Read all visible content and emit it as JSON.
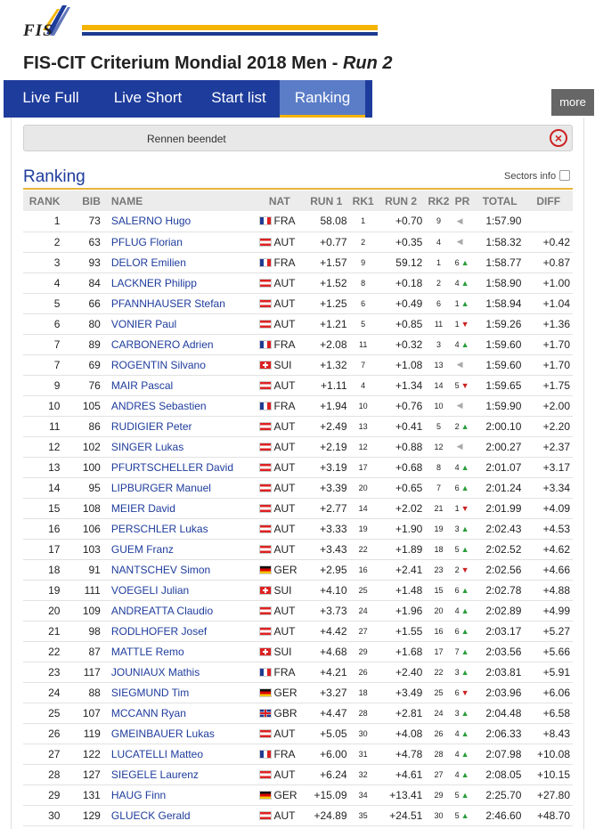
{
  "logo": {
    "text": "FIS"
  },
  "page": {
    "title_event": "FIS-CIT Criterium Mondial 2018 Men - ",
    "title_race": "Run 2"
  },
  "tabs": [
    {
      "label": "Live Full"
    },
    {
      "label": "Live Short"
    },
    {
      "label": "Start list"
    },
    {
      "label": "Ranking"
    }
  ],
  "more_label": "more",
  "notice": {
    "text": "Rennen beendet",
    "close_icon": "close-icon"
  },
  "ranking": {
    "title": "Ranking",
    "sectors_label": "Sectors info",
    "columns": [
      "RANK",
      "BIB",
      "NAME",
      "NAT",
      "RUN 1",
      "RK1",
      "RUN 2",
      "RK2",
      "PR",
      "TOTAL",
      "DIFF"
    ],
    "rows": [
      {
        "rank": "1",
        "bib": "73",
        "name": "SALERNO Hugo",
        "nat": "FRA",
        "run1": "58.08",
        "rk1": "1",
        "run2": "+0.70",
        "rk2": "9",
        "pr": "",
        "trend": "same",
        "total": "1:57.90",
        "diff": ""
      },
      {
        "rank": "2",
        "bib": "63",
        "name": "PFLUG Florian",
        "nat": "AUT",
        "run1": "+0.77",
        "rk1": "2",
        "run2": "+0.35",
        "rk2": "4",
        "pr": "",
        "trend": "same",
        "total": "1:58.32",
        "diff": "+0.42"
      },
      {
        "rank": "3",
        "bib": "93",
        "name": "DELOR Emilien",
        "nat": "FRA",
        "run1": "+1.57",
        "rk1": "9",
        "run2": "59.12",
        "rk2": "1",
        "pr": "6",
        "trend": "up",
        "total": "1:58.77",
        "diff": "+0.87"
      },
      {
        "rank": "4",
        "bib": "84",
        "name": "LACKNER Philipp",
        "nat": "AUT",
        "run1": "+1.52",
        "rk1": "8",
        "run2": "+0.18",
        "rk2": "2",
        "pr": "4",
        "trend": "up",
        "total": "1:58.90",
        "diff": "+1.00"
      },
      {
        "rank": "5",
        "bib": "66",
        "name": "PFANNHAUSER Stefan",
        "nat": "AUT",
        "run1": "+1.25",
        "rk1": "6",
        "run2": "+0.49",
        "rk2": "6",
        "pr": "1",
        "trend": "up",
        "total": "1:58.94",
        "diff": "+1.04"
      },
      {
        "rank": "6",
        "bib": "80",
        "name": "VONIER Paul",
        "nat": "AUT",
        "run1": "+1.21",
        "rk1": "5",
        "run2": "+0.85",
        "rk2": "11",
        "pr": "1",
        "trend": "down",
        "total": "1:59.26",
        "diff": "+1.36"
      },
      {
        "rank": "7",
        "bib": "89",
        "name": "CARBONERO Adrien",
        "nat": "FRA",
        "run1": "+2.08",
        "rk1": "11",
        "run2": "+0.32",
        "rk2": "3",
        "pr": "4",
        "trend": "up",
        "total": "1:59.60",
        "diff": "+1.70"
      },
      {
        "rank": "7",
        "bib": "69",
        "name": "ROGENTIN Silvano",
        "nat": "SUI",
        "run1": "+1.32",
        "rk1": "7",
        "run2": "+1.08",
        "rk2": "13",
        "pr": "",
        "trend": "same",
        "total": "1:59.60",
        "diff": "+1.70"
      },
      {
        "rank": "9",
        "bib": "76",
        "name": "MAIR Pascal",
        "nat": "AUT",
        "run1": "+1.11",
        "rk1": "4",
        "run2": "+1.34",
        "rk2": "14",
        "pr": "5",
        "trend": "down",
        "total": "1:59.65",
        "diff": "+1.75"
      },
      {
        "rank": "10",
        "bib": "105",
        "name": "ANDRES Sebastien",
        "nat": "FRA",
        "run1": "+1.94",
        "rk1": "10",
        "run2": "+0.76",
        "rk2": "10",
        "pr": "",
        "trend": "same",
        "total": "1:59.90",
        "diff": "+2.00"
      },
      {
        "rank": "11",
        "bib": "86",
        "name": "RUDIGIER Peter",
        "nat": "AUT",
        "run1": "+2.49",
        "rk1": "13",
        "run2": "+0.41",
        "rk2": "5",
        "pr": "2",
        "trend": "up",
        "total": "2:00.10",
        "diff": "+2.20"
      },
      {
        "rank": "12",
        "bib": "102",
        "name": "SINGER Lukas",
        "nat": "AUT",
        "run1": "+2.19",
        "rk1": "12",
        "run2": "+0.88",
        "rk2": "12",
        "pr": "",
        "trend": "same",
        "total": "2:00.27",
        "diff": "+2.37"
      },
      {
        "rank": "13",
        "bib": "100",
        "name": "PFURTSCHELLER David",
        "nat": "AUT",
        "run1": "+3.19",
        "rk1": "17",
        "run2": "+0.68",
        "rk2": "8",
        "pr": "4",
        "trend": "up",
        "total": "2:01.07",
        "diff": "+3.17"
      },
      {
        "rank": "14",
        "bib": "95",
        "name": "LIPBURGER Manuel",
        "nat": "AUT",
        "run1": "+3.39",
        "rk1": "20",
        "run2": "+0.65",
        "rk2": "7",
        "pr": "6",
        "trend": "up",
        "total": "2:01.24",
        "diff": "+3.34"
      },
      {
        "rank": "15",
        "bib": "108",
        "name": "MEIER David",
        "nat": "AUT",
        "run1": "+2.77",
        "rk1": "14",
        "run2": "+2.02",
        "rk2": "21",
        "pr": "1",
        "trend": "down",
        "total": "2:01.99",
        "diff": "+4.09"
      },
      {
        "rank": "16",
        "bib": "106",
        "name": "PERSCHLER Lukas",
        "nat": "AUT",
        "run1": "+3.33",
        "rk1": "19",
        "run2": "+1.90",
        "rk2": "19",
        "pr": "3",
        "trend": "up",
        "total": "2:02.43",
        "diff": "+4.53"
      },
      {
        "rank": "17",
        "bib": "103",
        "name": "GUEM Franz",
        "nat": "AUT",
        "run1": "+3.43",
        "rk1": "22",
        "run2": "+1.89",
        "rk2": "18",
        "pr": "5",
        "trend": "up",
        "total": "2:02.52",
        "diff": "+4.62"
      },
      {
        "rank": "18",
        "bib": "91",
        "name": "NANTSCHEV Simon",
        "nat": "GER",
        "run1": "+2.95",
        "rk1": "16",
        "run2": "+2.41",
        "rk2": "23",
        "pr": "2",
        "trend": "down",
        "total": "2:02.56",
        "diff": "+4.66"
      },
      {
        "rank": "19",
        "bib": "111",
        "name": "VOEGELI Julian",
        "nat": "SUI",
        "run1": "+4.10",
        "rk1": "25",
        "run2": "+1.48",
        "rk2": "15",
        "pr": "6",
        "trend": "up",
        "total": "2:02.78",
        "diff": "+4.88"
      },
      {
        "rank": "20",
        "bib": "109",
        "name": "ANDREATTA Claudio",
        "nat": "AUT",
        "run1": "+3.73",
        "rk1": "24",
        "run2": "+1.96",
        "rk2": "20",
        "pr": "4",
        "trend": "up",
        "total": "2:02.89",
        "diff": "+4.99"
      },
      {
        "rank": "21",
        "bib": "98",
        "name": "RODLHOFER Josef",
        "nat": "AUT",
        "run1": "+4.42",
        "rk1": "27",
        "run2": "+1.55",
        "rk2": "16",
        "pr": "6",
        "trend": "up",
        "total": "2:03.17",
        "diff": "+5.27"
      },
      {
        "rank": "22",
        "bib": "87",
        "name": "MATTLE Remo",
        "nat": "SUI",
        "run1": "+4.68",
        "rk1": "29",
        "run2": "+1.68",
        "rk2": "17",
        "pr": "7",
        "trend": "up",
        "total": "2:03.56",
        "diff": "+5.66"
      },
      {
        "rank": "23",
        "bib": "117",
        "name": "JOUNIAUX Mathis",
        "nat": "FRA",
        "run1": "+4.21",
        "rk1": "26",
        "run2": "+2.40",
        "rk2": "22",
        "pr": "3",
        "trend": "up",
        "total": "2:03.81",
        "diff": "+5.91"
      },
      {
        "rank": "24",
        "bib": "88",
        "name": "SIEGMUND Tim",
        "nat": "GER",
        "run1": "+3.27",
        "rk1": "18",
        "run2": "+3.49",
        "rk2": "25",
        "pr": "6",
        "trend": "down",
        "total": "2:03.96",
        "diff": "+6.06"
      },
      {
        "rank": "25",
        "bib": "107",
        "name": "MCCANN Ryan",
        "nat": "GBR",
        "run1": "+4.47",
        "rk1": "28",
        "run2": "+2.81",
        "rk2": "24",
        "pr": "3",
        "trend": "up",
        "total": "2:04.48",
        "diff": "+6.58"
      },
      {
        "rank": "26",
        "bib": "119",
        "name": "GMEINBAUER Lukas",
        "nat": "AUT",
        "run1": "+5.05",
        "rk1": "30",
        "run2": "+4.08",
        "rk2": "26",
        "pr": "4",
        "trend": "up",
        "total": "2:06.33",
        "diff": "+8.43"
      },
      {
        "rank": "27",
        "bib": "122",
        "name": "LUCATELLI Matteo",
        "nat": "FRA",
        "run1": "+6.00",
        "rk1": "31",
        "run2": "+4.78",
        "rk2": "28",
        "pr": "4",
        "trend": "up",
        "total": "2:07.98",
        "diff": "+10.08"
      },
      {
        "rank": "28",
        "bib": "127",
        "name": "SIEGELE Laurenz",
        "nat": "AUT",
        "run1": "+6.24",
        "rk1": "32",
        "run2": "+4.61",
        "rk2": "27",
        "pr": "4",
        "trend": "up",
        "total": "2:08.05",
        "diff": "+10.15"
      },
      {
        "rank": "29",
        "bib": "131",
        "name": "HAUG Finn",
        "nat": "GER",
        "run1": "+15.09",
        "rk1": "34",
        "run2": "+13.41",
        "rk2": "29",
        "pr": "5",
        "trend": "up",
        "total": "2:25.70",
        "diff": "+27.80"
      },
      {
        "rank": "30",
        "bib": "129",
        "name": "GLUECK Gerald",
        "nat": "AUT",
        "run1": "+24.89",
        "rk1": "35",
        "run2": "+24.51",
        "rk2": "30",
        "pr": "5",
        "trend": "up",
        "total": "2:46.60",
        "diff": "+48.70"
      }
    ]
  },
  "colors": {
    "tab_bar": "#1e3c9c",
    "tab_active": "#5b7dc8",
    "accent_gold": "#f5b400",
    "name_link": "#1e3c9c",
    "trend_up": "#2a9d3a",
    "trend_down": "#cc2222"
  }
}
